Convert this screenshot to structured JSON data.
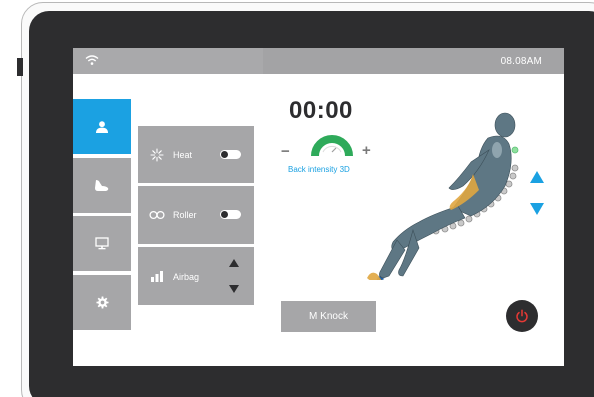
{
  "status_bar": {
    "wifi_icon": "wifi-icon",
    "clock": "08.08AM"
  },
  "sidebar": {
    "items": [
      {
        "name": "person-icon",
        "active": true
      },
      {
        "name": "foot-icon",
        "active": false
      },
      {
        "name": "monitor-icon",
        "active": false
      },
      {
        "name": "gear-icon",
        "active": false
      }
    ]
  },
  "controls": {
    "heat": {
      "icon": "heat-icon",
      "label": "Heat",
      "toggle": "off"
    },
    "roller": {
      "icon": "roller-icon",
      "label": "Roller",
      "toggle": "off"
    },
    "airbag": {
      "icon": "airbag-icon",
      "label": "Airbag"
    }
  },
  "timer": "00:00",
  "intensity": {
    "label": "Back intensity 3D",
    "minus": "−",
    "plus": "+",
    "level": 0.5
  },
  "buttons": {
    "mknock": "M Knock",
    "power_icon": "power-icon"
  },
  "colors": {
    "accent": "#1ba1e2",
    "tile": "#a6a6a8",
    "status_bar": "#a3a3a5",
    "frame": "#2d2d2f",
    "power_red": "#e53935",
    "gauge_green": "#2eaa5a"
  }
}
